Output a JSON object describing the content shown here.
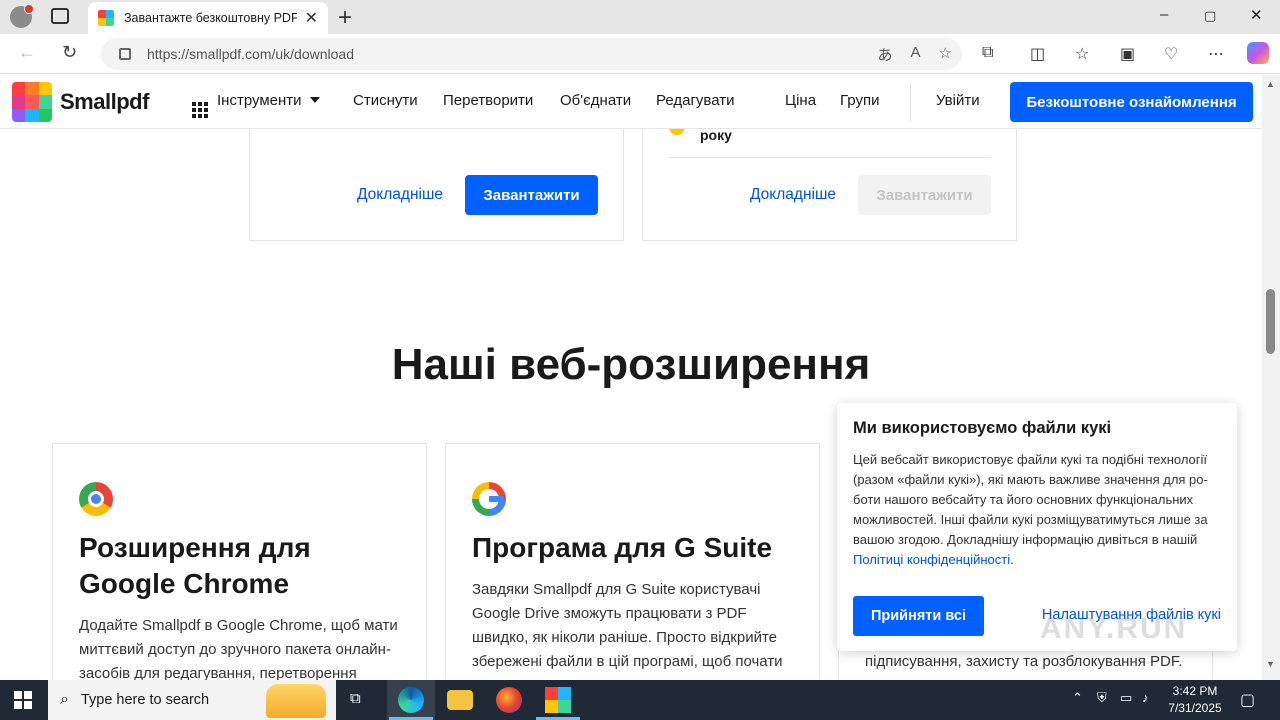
{
  "browser": {
    "tab_title": "Завантажте безкоштовну PDF-п",
    "url": "https://smallpdf.com/uk/download",
    "window_controls": [
      "–",
      "▢",
      "✕"
    ]
  },
  "site": {
    "logo_text": "Smallpdf",
    "nav": {
      "tools": "Інструменти",
      "compress": "Стиснути",
      "convert": "Перетворити",
      "merge": "Об'єднати",
      "edit": "Редагувати",
      "price": "Ціна",
      "teams": "Групи",
      "login": "Увійти",
      "trial": "Безкоштовне ознайомлення"
    },
    "brand_color": "#0061fe"
  },
  "top_cards": {
    "left": {
      "more": "Докладніше",
      "download": "Завантажити"
    },
    "right": {
      "partial_text": "року",
      "more": "Докладніше",
      "download": "Завантажити"
    }
  },
  "extensions": {
    "heading": "Наші веб-розширення",
    "cards": [
      {
        "icon": "chrome-icon",
        "title": "Розширення для Google Chrome",
        "text": "Додайте Smallpdf в Google Chrome, щоб мати миттєвий доступ до зручного пакета онлайн-засобів для редагування, перетворення"
      },
      {
        "icon": "google-g-icon",
        "title": "Програма для G Suite",
        "text": "Завдяки Smallpdf для G Suite користувачі Google Drive зможуть працювати з PDF швидко, як ніколи раніше. Просто відкрийте збережені файли в цій програмі, щоб почати"
      },
      {
        "text_visible": "підписування, захисту та розблокування PDF."
      }
    ]
  },
  "cookie": {
    "title": "Ми використовуємо файли кукі",
    "text": "Цей вебсайт використовує файли кукі та подібні технології (разом «файли кукі»), які мають важливе значення для ро­боти нашого вебсайту та його основних функціональних можливостей. Інші файли кукі розміщуватимуться лише за вашою згодою. Докладнішу інформацію дивіться в нашій ",
    "link": "Політиці конфіденційності",
    "link_suffix": ".",
    "accept": "Прийняти всі",
    "settings": "Налаштування файлів кукі"
  },
  "watermark": "ANY.RUN",
  "taskbar": {
    "search_placeholder": "Type here to search",
    "time": "3:42 PM",
    "date": "7/31/2025"
  }
}
